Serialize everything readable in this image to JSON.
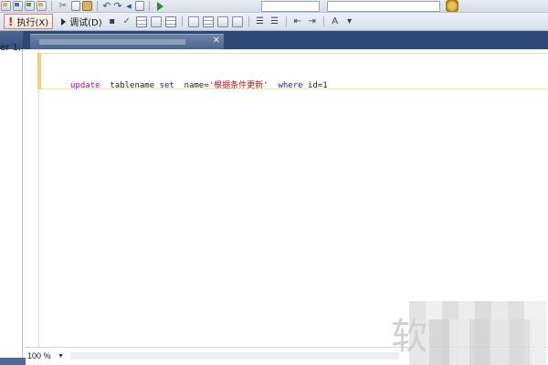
{
  "toolbar_top": {
    "icons": [
      "new-query-icon",
      "open-file-icon",
      "save-icon",
      "save-all-icon",
      "cut-icon",
      "copy-icon",
      "paste-icon",
      "undo-icon",
      "redo-icon",
      "navigate-back-icon",
      "activity-monitor-icon",
      "start-icon",
      "properties-gear-icon"
    ]
  },
  "toolbar_query": {
    "execute": {
      "mark": "!",
      "label": "执行(X)"
    },
    "debug": {
      "label": "调试(D)"
    },
    "icons": [
      "stop-icon",
      "parse-check-icon",
      "results-to-grid-icon",
      "display-plan-icon",
      "query-options-icon",
      "results-to-text-icon",
      "results-to-file-icon",
      "comment-icon",
      "uncomment-icon",
      "decrease-indent-icon",
      "increase-indent-icon",
      "specify-values-icon"
    ]
  },
  "object_explorer": {
    "partial_text": "er 1,"
  },
  "editor": {
    "code": {
      "kw_update": "update",
      "table": "tablename",
      "kw_set": "set",
      "assign": "name=",
      "string": "'根据条件更新'",
      "kw_where": "where",
      "condition": "id=1"
    }
  },
  "status": {
    "zoom": "100 %"
  },
  "watermark": {
    "glyph": "软"
  }
}
